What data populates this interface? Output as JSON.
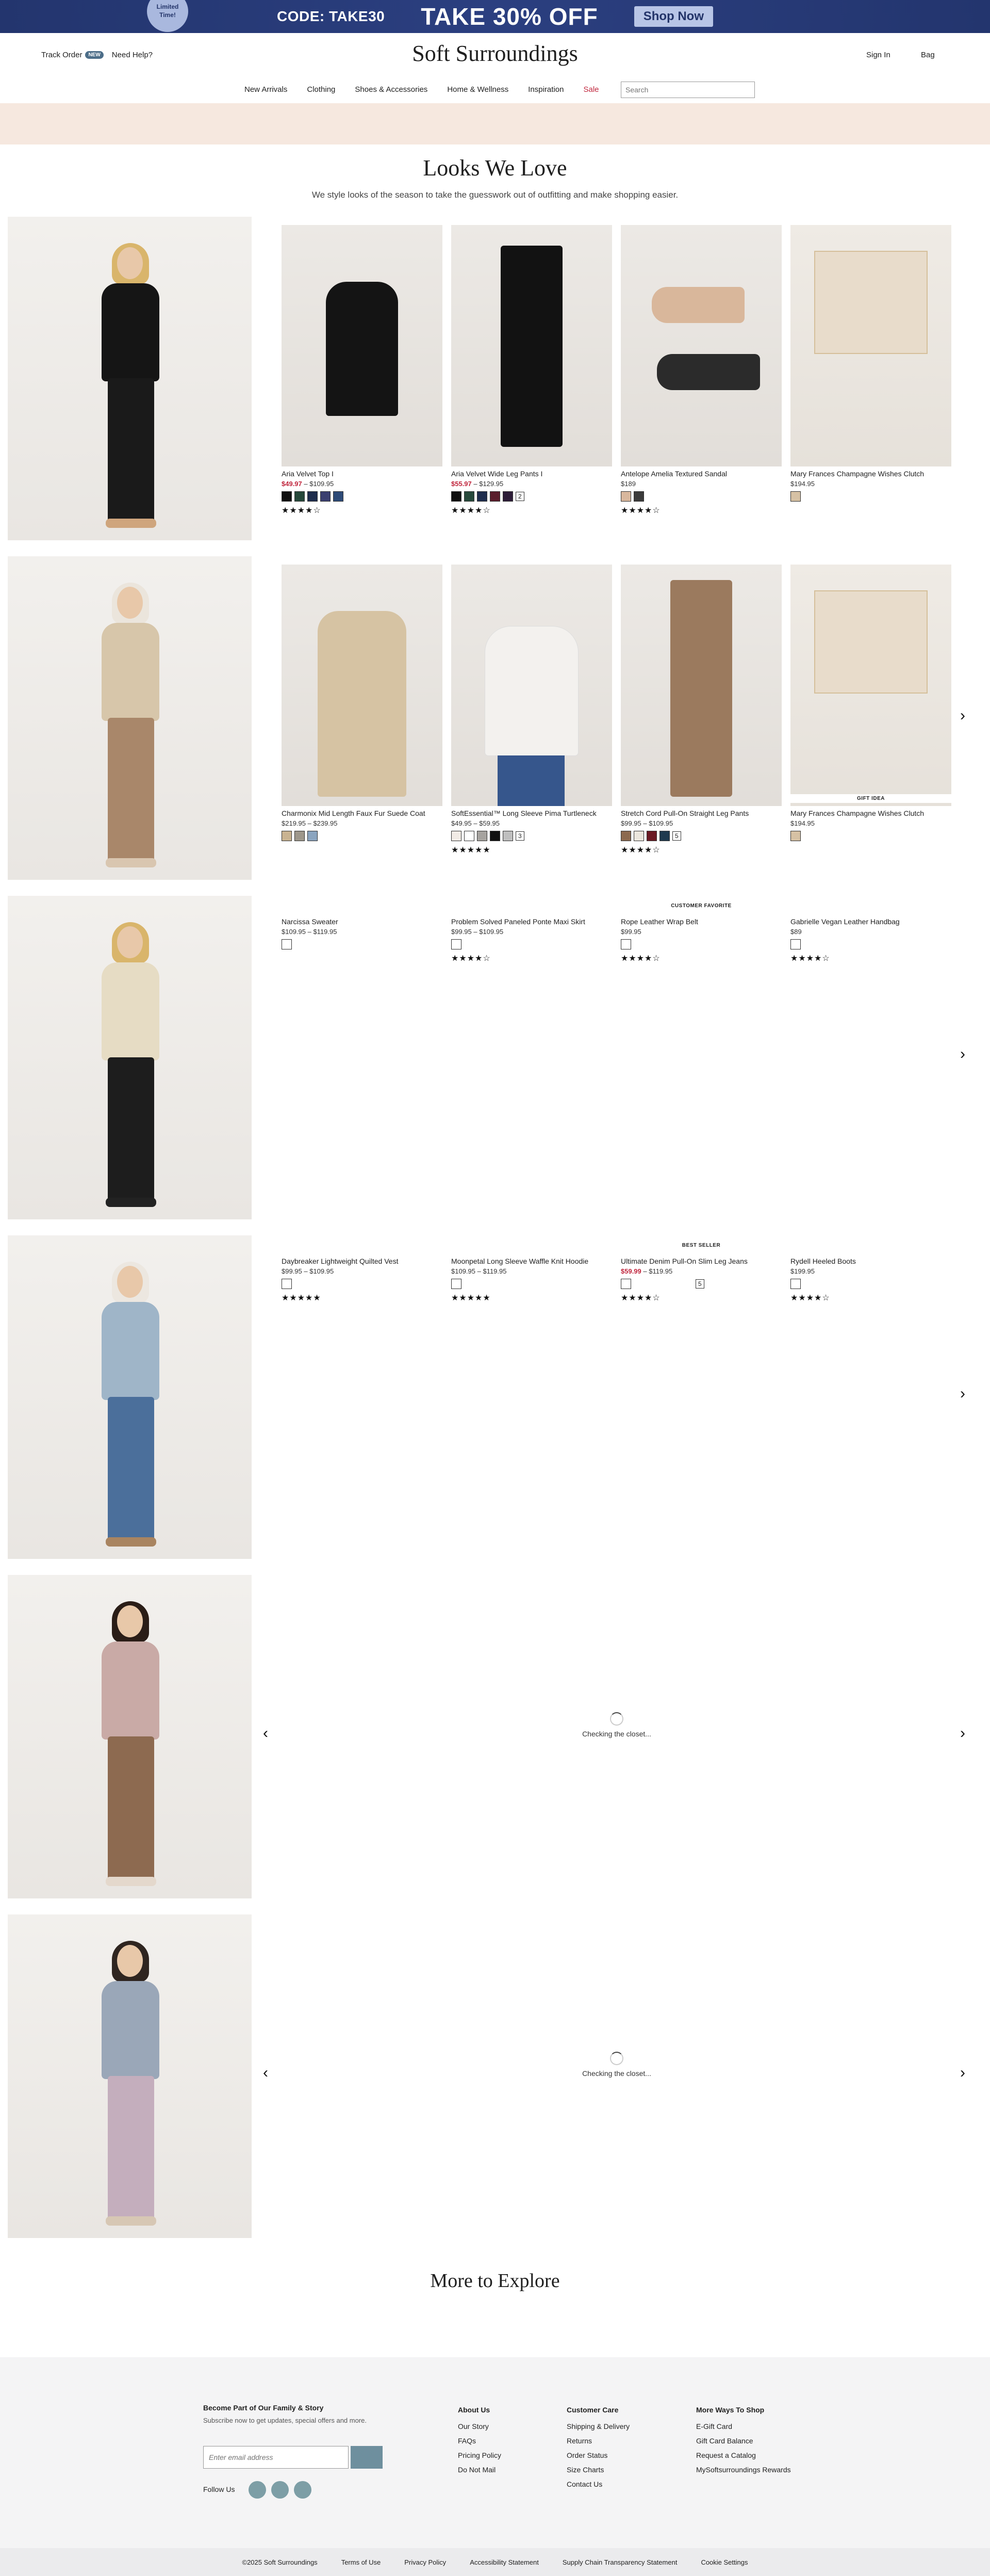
{
  "promo": {
    "badge_line1": "Limited",
    "badge_line2": "Time!",
    "code": "CODE: TAKE30",
    "headline": "TAKE 30% OFF",
    "cta": "Shop Now"
  },
  "header": {
    "track_order": "Track Order",
    "new_badge": "NEW",
    "need_help": "Need Help?",
    "logo": "Soft Surroundings",
    "sign_in": "Sign In",
    "bag": "Bag"
  },
  "nav": {
    "items": [
      "New Arrivals",
      "Clothing",
      "Shoes & Accessories",
      "Home & Wellness",
      "Inspiration",
      "Sale"
    ],
    "search_placeholder": "Search"
  },
  "page": {
    "title": "Looks We Love",
    "subtitle": "We style looks of the season to take the guesswork out of outfitting and make shopping easier."
  },
  "looks": [
    {
      "products": [
        {
          "name": "Aria Velvet Top I",
          "sale": "$49.97",
          "price": " – $109.95",
          "swatches": [
            "#111111",
            "#27493b",
            "#1f2d4d",
            "#3b3f70",
            "#2d4a77"
          ],
          "stars": "★★★★☆"
        },
        {
          "name": "Aria Velvet Wide Leg Pants I",
          "sale": "$55.97",
          "price": " – $129.95",
          "swatches": [
            "#111111",
            "#27493b",
            "#1f2d4d",
            "#5a1e2c",
            "#2d1d38"
          ],
          "more": "2",
          "stars": "★★★★☆"
        },
        {
          "name": "Antelope Amelia Textured Sandal",
          "sale": "",
          "price": "$189",
          "swatches": [
            "#d8b79d",
            "#3b3b3b"
          ],
          "stars": "★★★★☆"
        },
        {
          "name": "Mary Frances Champagne Wishes Clutch",
          "sale": "",
          "price": "$194.95",
          "swatches": [
            "#d6c1a4"
          ],
          "stars": ""
        }
      ]
    },
    {
      "products": [
        {
          "name": "Charmonix Mid Length Faux Fur Suede Coat",
          "sale": "",
          "price": "$219.95 – $239.95",
          "swatches": [
            "#c9b391",
            "#9e978b",
            "#8aa4bf"
          ],
          "stars": ""
        },
        {
          "name": "SoftEssential™ Long Sleeve Pima Turtleneck",
          "sale": "",
          "price": "$49.95 – $59.95",
          "swatches": [
            "#f2ece6",
            "#ffffff",
            "#a6a39f",
            "#111111",
            "#bfbfbf"
          ],
          "more": "3",
          "stars": "★★★★★"
        },
        {
          "name": "Stretch Cord Pull-On Straight Leg Pants",
          "sale": "",
          "price": "$99.95 – $109.95",
          "swatches": [
            "#8c6a4f",
            "#ece7de",
            "#6b1a24",
            "#203a4f"
          ],
          "more": "5",
          "stars": "★★★★☆"
        },
        {
          "name": "Mary Frances Champagne Wishes Clutch",
          "tag": "GIFT IDEA",
          "sale": "",
          "price": "$194.95",
          "swatches": [
            "#d6c1a4"
          ],
          "stars": ""
        }
      ]
    },
    {
      "products": [
        {
          "name": "Narcissa Sweater",
          "sale": "",
          "price": "$109.95 – $119.95",
          "swatches": [
            "#ffffff"
          ],
          "stars": ""
        },
        {
          "name": "Problem Solved Paneled Ponte Maxi Skirt",
          "sale": "",
          "price": "$99.95 – $109.95",
          "swatches": [
            "#ffffff"
          ],
          "stars": "★★★★☆"
        },
        {
          "name": "Rope Leather Wrap Belt",
          "tag": "CUSTOMER FAVORITE",
          "sale": "",
          "price": "$99.95",
          "swatches": [
            "#ffffff"
          ],
          "stars": "★★★★☆"
        },
        {
          "name": "Gabrielle Vegan Leather Handbag",
          "sale": "",
          "price": "$89",
          "swatches": [
            "#ffffff"
          ],
          "stars": "★★★★☆"
        }
      ]
    },
    {
      "products": [
        {
          "name": "Daybreaker Lightweight Quilted Vest",
          "sale": "",
          "price": "$99.95 – $109.95",
          "swatches": [
            "#ffffff"
          ],
          "stars": "★★★★★"
        },
        {
          "name": "Moonpetal Long Sleeve Waffle Knit Hoodie",
          "sale": "",
          "price": "$109.95 – $119.95",
          "swatches": [
            "#ffffff"
          ],
          "stars": "★★★★★"
        },
        {
          "name": "Ultimate Denim Pull-On Slim Leg Jeans",
          "tag": "BEST SELLER",
          "sale": "$59.99",
          "price": " – $119.95",
          "swatches": [
            "#ffffff"
          ],
          "more": "5",
          "stars": "★★★★☆"
        },
        {
          "name": "Rydell Heeled Boots",
          "sale": "",
          "price": "$199.95",
          "swatches": [
            "#ffffff"
          ],
          "stars": "★★★★☆"
        }
      ]
    }
  ],
  "loading_text": "Checking the closet...",
  "arrows": {
    "next": "›",
    "prev": "‹"
  },
  "explore_title": "More to Explore",
  "footer": {
    "signup_title": "Become Part of Our Family & Story",
    "signup_sub": "Subscribe now to get updates, special offers and more.",
    "email_placeholder": "Enter email address",
    "follow": "Follow Us",
    "about": {
      "title": "About Us",
      "links": [
        "Our Story",
        "FAQs",
        "Pricing Policy",
        "Do Not Mail"
      ]
    },
    "care": {
      "title": "Customer Care",
      "links": [
        "Shipping & Delivery",
        "Returns",
        "Order Status",
        "Size Charts",
        "Contact Us"
      ]
    },
    "more": {
      "title": "More Ways To Shop",
      "links": [
        "E-Gift Card",
        "Gift Card Balance",
        "Request a Catalog",
        "MySoftsurroundings Rewards"
      ]
    },
    "legal": [
      "©2025 Soft Surroundings",
      "Terms of Use",
      "Privacy Policy",
      "Accessibility Statement",
      "Supply Chain Transparency Statement",
      "Cookie Settings"
    ]
  }
}
